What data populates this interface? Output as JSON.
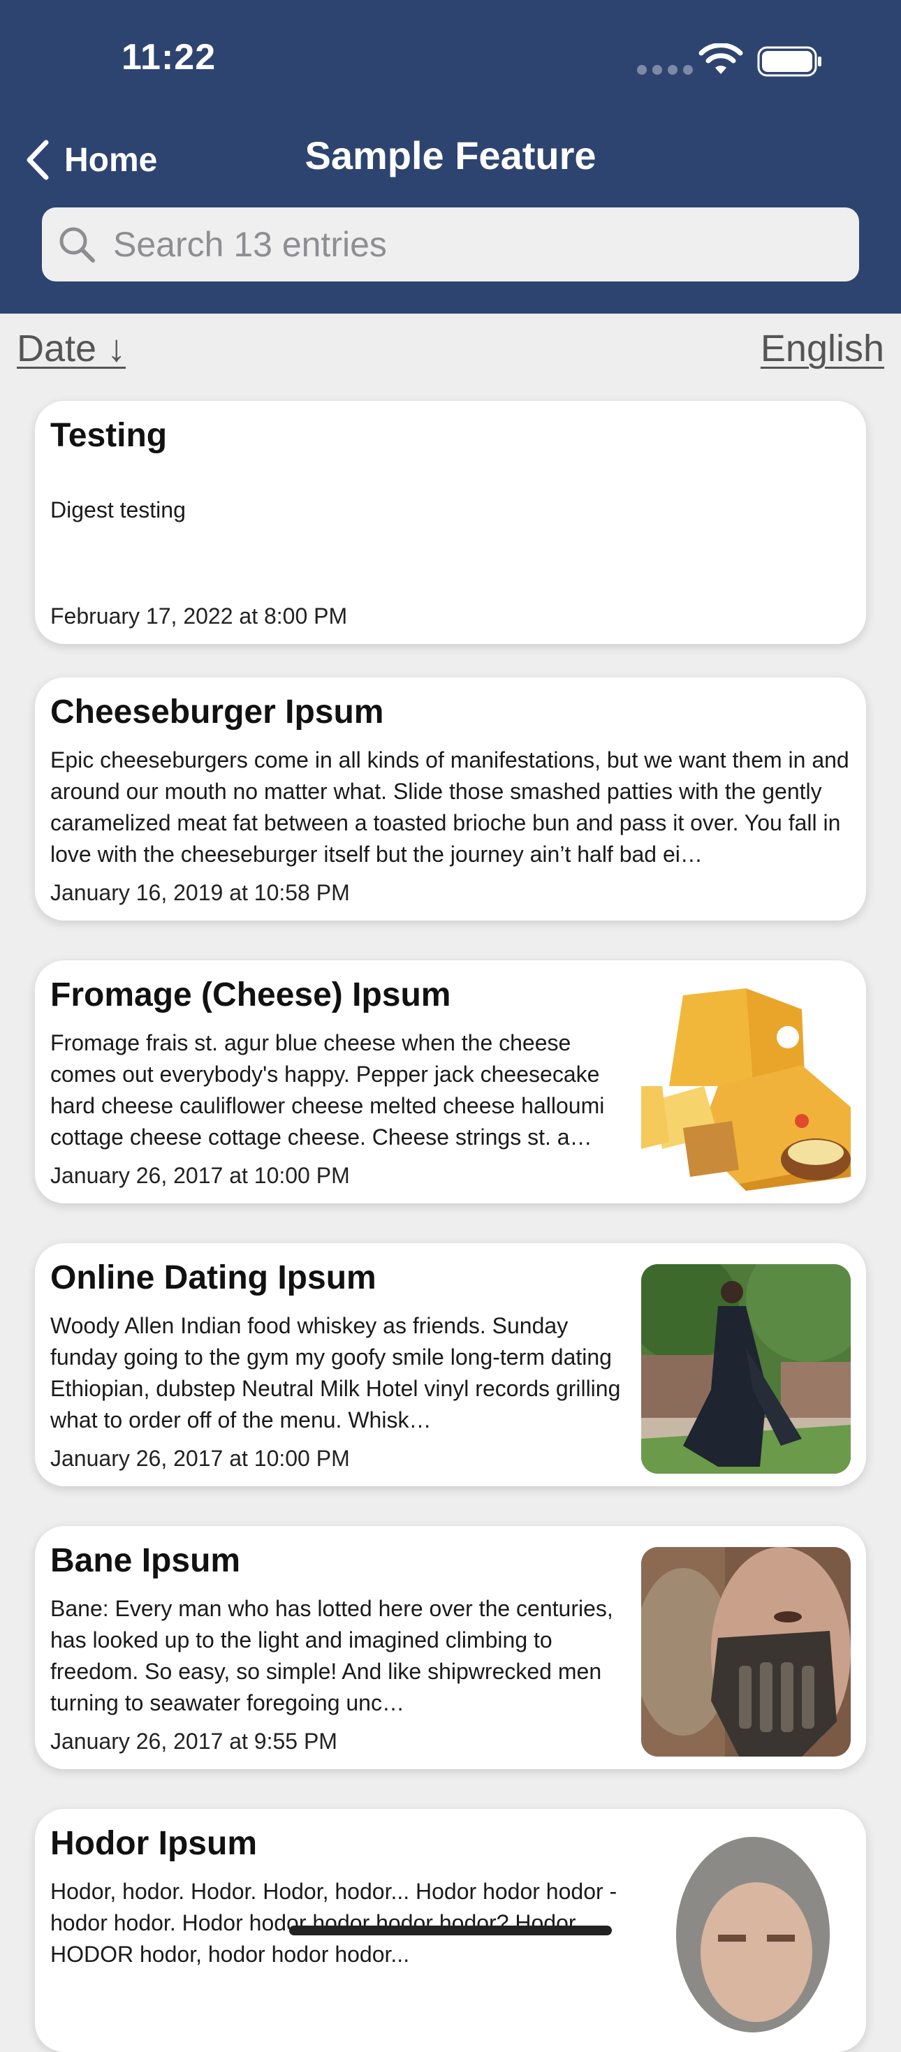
{
  "status_bar": {
    "time": "11:22"
  },
  "nav": {
    "back_label": "Home",
    "title": "Sample Feature"
  },
  "search": {
    "placeholder": "Search 13 entries"
  },
  "sort": {
    "date_label": "Date ↓",
    "language_label": "English"
  },
  "entries": [
    {
      "title": "Testing",
      "body": "Digest testing",
      "date": "February 17, 2022 at 8:00 PM",
      "image": null
    },
    {
      "title": "Cheeseburger Ipsum",
      "body": "Epic cheeseburgers come in all kinds of manifestations, but we want them in and around our mouth no matter what. Slide those smashed patties with the gently caramelized meat fat between a toasted brioche bun and pass it over. You fall in love with the cheeseburger itself but the journey ain’t half bad ei…",
      "date": "January 16, 2019 at 10:58 PM",
      "image": null
    },
    {
      "title": "Fromage (Cheese) Ipsum",
      "body": "Fromage frais st. agur blue cheese when the cheese comes out everybody's happy. Pepper jack cheesecake hard cheese cauliflower cheese melted cheese halloumi cottage cheese cottage cheese. Cheese strings st. a…",
      "date": "January 26, 2017 at 10:00 PM",
      "image": "cheese-photo"
    },
    {
      "title": "Online Dating Ipsum",
      "body": "Woody Allen Indian food whiskey as friends. Sunday funday going to the gym my goofy smile long-term dating Ethiopian, dubstep Neutral Milk Hotel vinyl records grilling what to order off of the menu. Whisk…",
      "date": "January 26, 2017 at 10:00 PM",
      "image": "man-in-black-coat-photo"
    },
    {
      "title": "Bane Ipsum",
      "body": "Bane: Every man who has lotted here over the centuries, has looked up to the light and imagined climbing to freedom. So easy, so simple! And like shipwrecked men turning to seawater foregoing unc…",
      "date": "January 26, 2017 at 9:55 PM",
      "image": "bane-mask-photo"
    },
    {
      "title": "Hodor Ipsum",
      "body": "Hodor, hodor. Hodor. Hodor, hodor... Hodor hodor hodor - hodor hodor. Hodor hodor hodor hodor hodor? Hodor. HODOR hodor, hodor hodor hodor...",
      "date": "",
      "image": "hodor-portrait-photo"
    }
  ],
  "colors": {
    "header": "#2e4470",
    "background": "#eeeeee",
    "card": "#ffffff"
  }
}
